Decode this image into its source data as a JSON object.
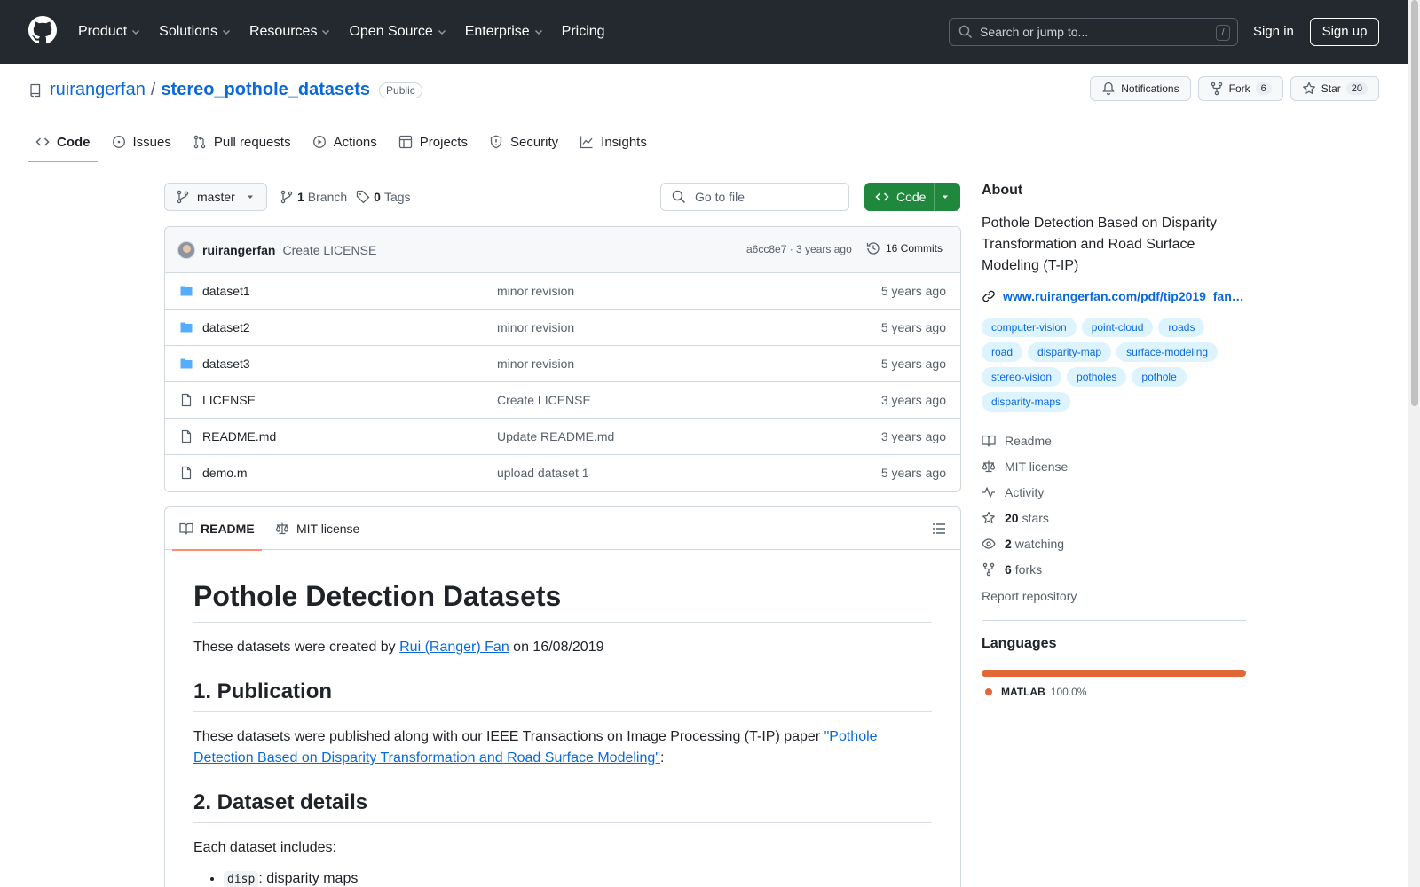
{
  "topnav": [
    "Product",
    "Solutions",
    "Resources",
    "Open Source",
    "Enterprise",
    "Pricing"
  ],
  "search": {
    "placeholder": "Search or jump to...",
    "shortcut": "/"
  },
  "auth": {
    "signin": "Sign in",
    "signup": "Sign up"
  },
  "repo": {
    "owner": "ruirangerfan",
    "separator": "/",
    "name": "stereo_pothole_datasets",
    "visibility": "Public"
  },
  "actions": {
    "notifications": "Notifications",
    "fork": "Fork",
    "fork_count": "6",
    "star": "Star",
    "star_count": "20"
  },
  "tabs": [
    "Code",
    "Issues",
    "Pull requests",
    "Actions",
    "Projects",
    "Security",
    "Insights"
  ],
  "branch": {
    "name": "master",
    "branch_count": "1",
    "branch_label": "Branch",
    "tag_count": "0",
    "tag_label": "Tags"
  },
  "goto_file": "Go to file",
  "code_button": "Code",
  "commit": {
    "author": "ruirangerfan",
    "message": "Create LICENSE",
    "meta": "a6cc8e7 · 3 years ago",
    "commits": "16 Commits"
  },
  "files": [
    {
      "name": "dataset1",
      "type": "dir",
      "message": "minor revision",
      "age": "5 years ago"
    },
    {
      "name": "dataset2",
      "type": "dir",
      "message": "minor revision",
      "age": "5 years ago"
    },
    {
      "name": "dataset3",
      "type": "dir",
      "message": "minor revision",
      "age": "5 years ago"
    },
    {
      "name": "LICENSE",
      "type": "file",
      "message": "Create LICENSE",
      "age": "3 years ago"
    },
    {
      "name": "README.md",
      "type": "file",
      "message": "Update README.md",
      "age": "3 years ago"
    },
    {
      "name": "demo.m",
      "type": "file",
      "message": "upload dataset 1",
      "age": "5 years ago"
    }
  ],
  "readme_tabs": {
    "readme": "README",
    "license": "MIT license"
  },
  "readme": {
    "title": "Pothole Detection Datasets",
    "intro_pre": "These datasets were created by ",
    "intro_link": "Rui (Ranger) Fan",
    "intro_post": " on 16/08/2019",
    "h_pub": "1. Publication",
    "pub_pre": "These datasets were published along with our IEEE Transactions on Image Processing (T-IP) paper ",
    "pub_link": "\"Pothole Detection Based on Disparity Transformation and Road Surface Modeling\"",
    "pub_post": ":",
    "h_details": "2. Dataset details",
    "details_intro": "Each dataset includes:",
    "list_code": "disp",
    "list_text": ": disparity maps"
  },
  "about": {
    "heading": "About",
    "description": "Pothole Detection Based on Disparity Transformation and Road Surface Modeling (T-IP)",
    "website": "www.ruirangerfan.com/pdf/tip2019_fan.pdf",
    "topics": [
      "computer-vision",
      "point-cloud",
      "roads",
      "road",
      "disparity-map",
      "surface-modeling",
      "stereo-vision",
      "potholes",
      "pothole",
      "disparity-maps"
    ],
    "readme": "Readme",
    "license": "MIT license",
    "activity": "Activity",
    "stars_count": "20",
    "stars_label": "stars",
    "watching_count": "2",
    "watching_label": "watching",
    "forks_count": "6",
    "forks_label": "forks",
    "report": "Report repository"
  },
  "languages": {
    "heading": "Languages",
    "items": [
      {
        "name": "MATLAB",
        "percent": "100.0%",
        "color": "#e16737"
      }
    ]
  }
}
